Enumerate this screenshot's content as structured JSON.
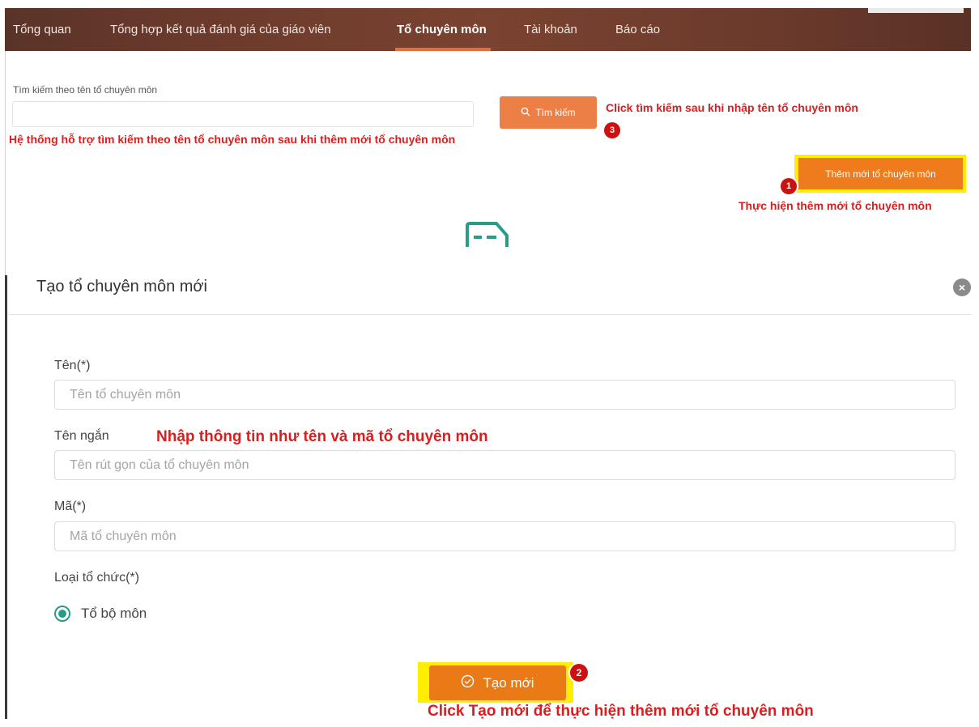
{
  "nav": {
    "items": [
      {
        "label": "Tổng quan"
      },
      {
        "label": "Tổng hợp kết quả đánh giá của giáo viên"
      },
      {
        "label": "Tổ chuyên môn"
      },
      {
        "label": "Tài khoản"
      },
      {
        "label": "Báo cáo"
      }
    ],
    "active_index": 2
  },
  "search": {
    "label": "Tìm kiếm theo tên tổ chuyên môn",
    "value": "",
    "button_label": "Tìm kiếm",
    "icon": "search-icon"
  },
  "add_button_label": "Thêm mới tổ chuyên môn",
  "dialog": {
    "title": "Tạo tổ chuyên môn mới",
    "close_icon": "close-icon",
    "fields": [
      {
        "label": "Tên(*)",
        "placeholder": "Tên tổ chuyên môn",
        "value": ""
      },
      {
        "label": "Tên ngắn",
        "placeholder": "Tên rút gọn của tổ chuyên môn",
        "value": ""
      },
      {
        "label": "Mã(*)",
        "placeholder": "Mã tổ chuyên môn",
        "value": ""
      }
    ],
    "org_type": {
      "label": "Loại tổ chức(*)",
      "options": [
        {
          "label": "Tổ bộ môn",
          "selected": true
        }
      ]
    },
    "create_button_label": "Tạo mới"
  },
  "annotations": {
    "search_click": "Click tìm kiếm sau khi nhập tên tổ chuyên môn",
    "search_support": "Hệ thống hỗ trợ tìm kiếm theo tên tổ chuyên môn sau khi thêm mới tổ chuyên môn",
    "add_new": "Thực hiện thêm mới tổ chuyên môn",
    "enter_info": "Nhập thông tin như tên và mã tổ chuyên môn",
    "click_create": "Click Tạo mới để thực hiện thêm mới tổ chuyên môn"
  },
  "badges": {
    "add": "1",
    "create": "2",
    "search": "3"
  },
  "colors": {
    "accent": "#ec7f45",
    "button_orange": "#ea7a16",
    "highlight": "#ffee00",
    "annotation_red": "#d61f1f",
    "radio_teal": "#2a9a8a",
    "nav_bg": "#6b3a2c"
  }
}
